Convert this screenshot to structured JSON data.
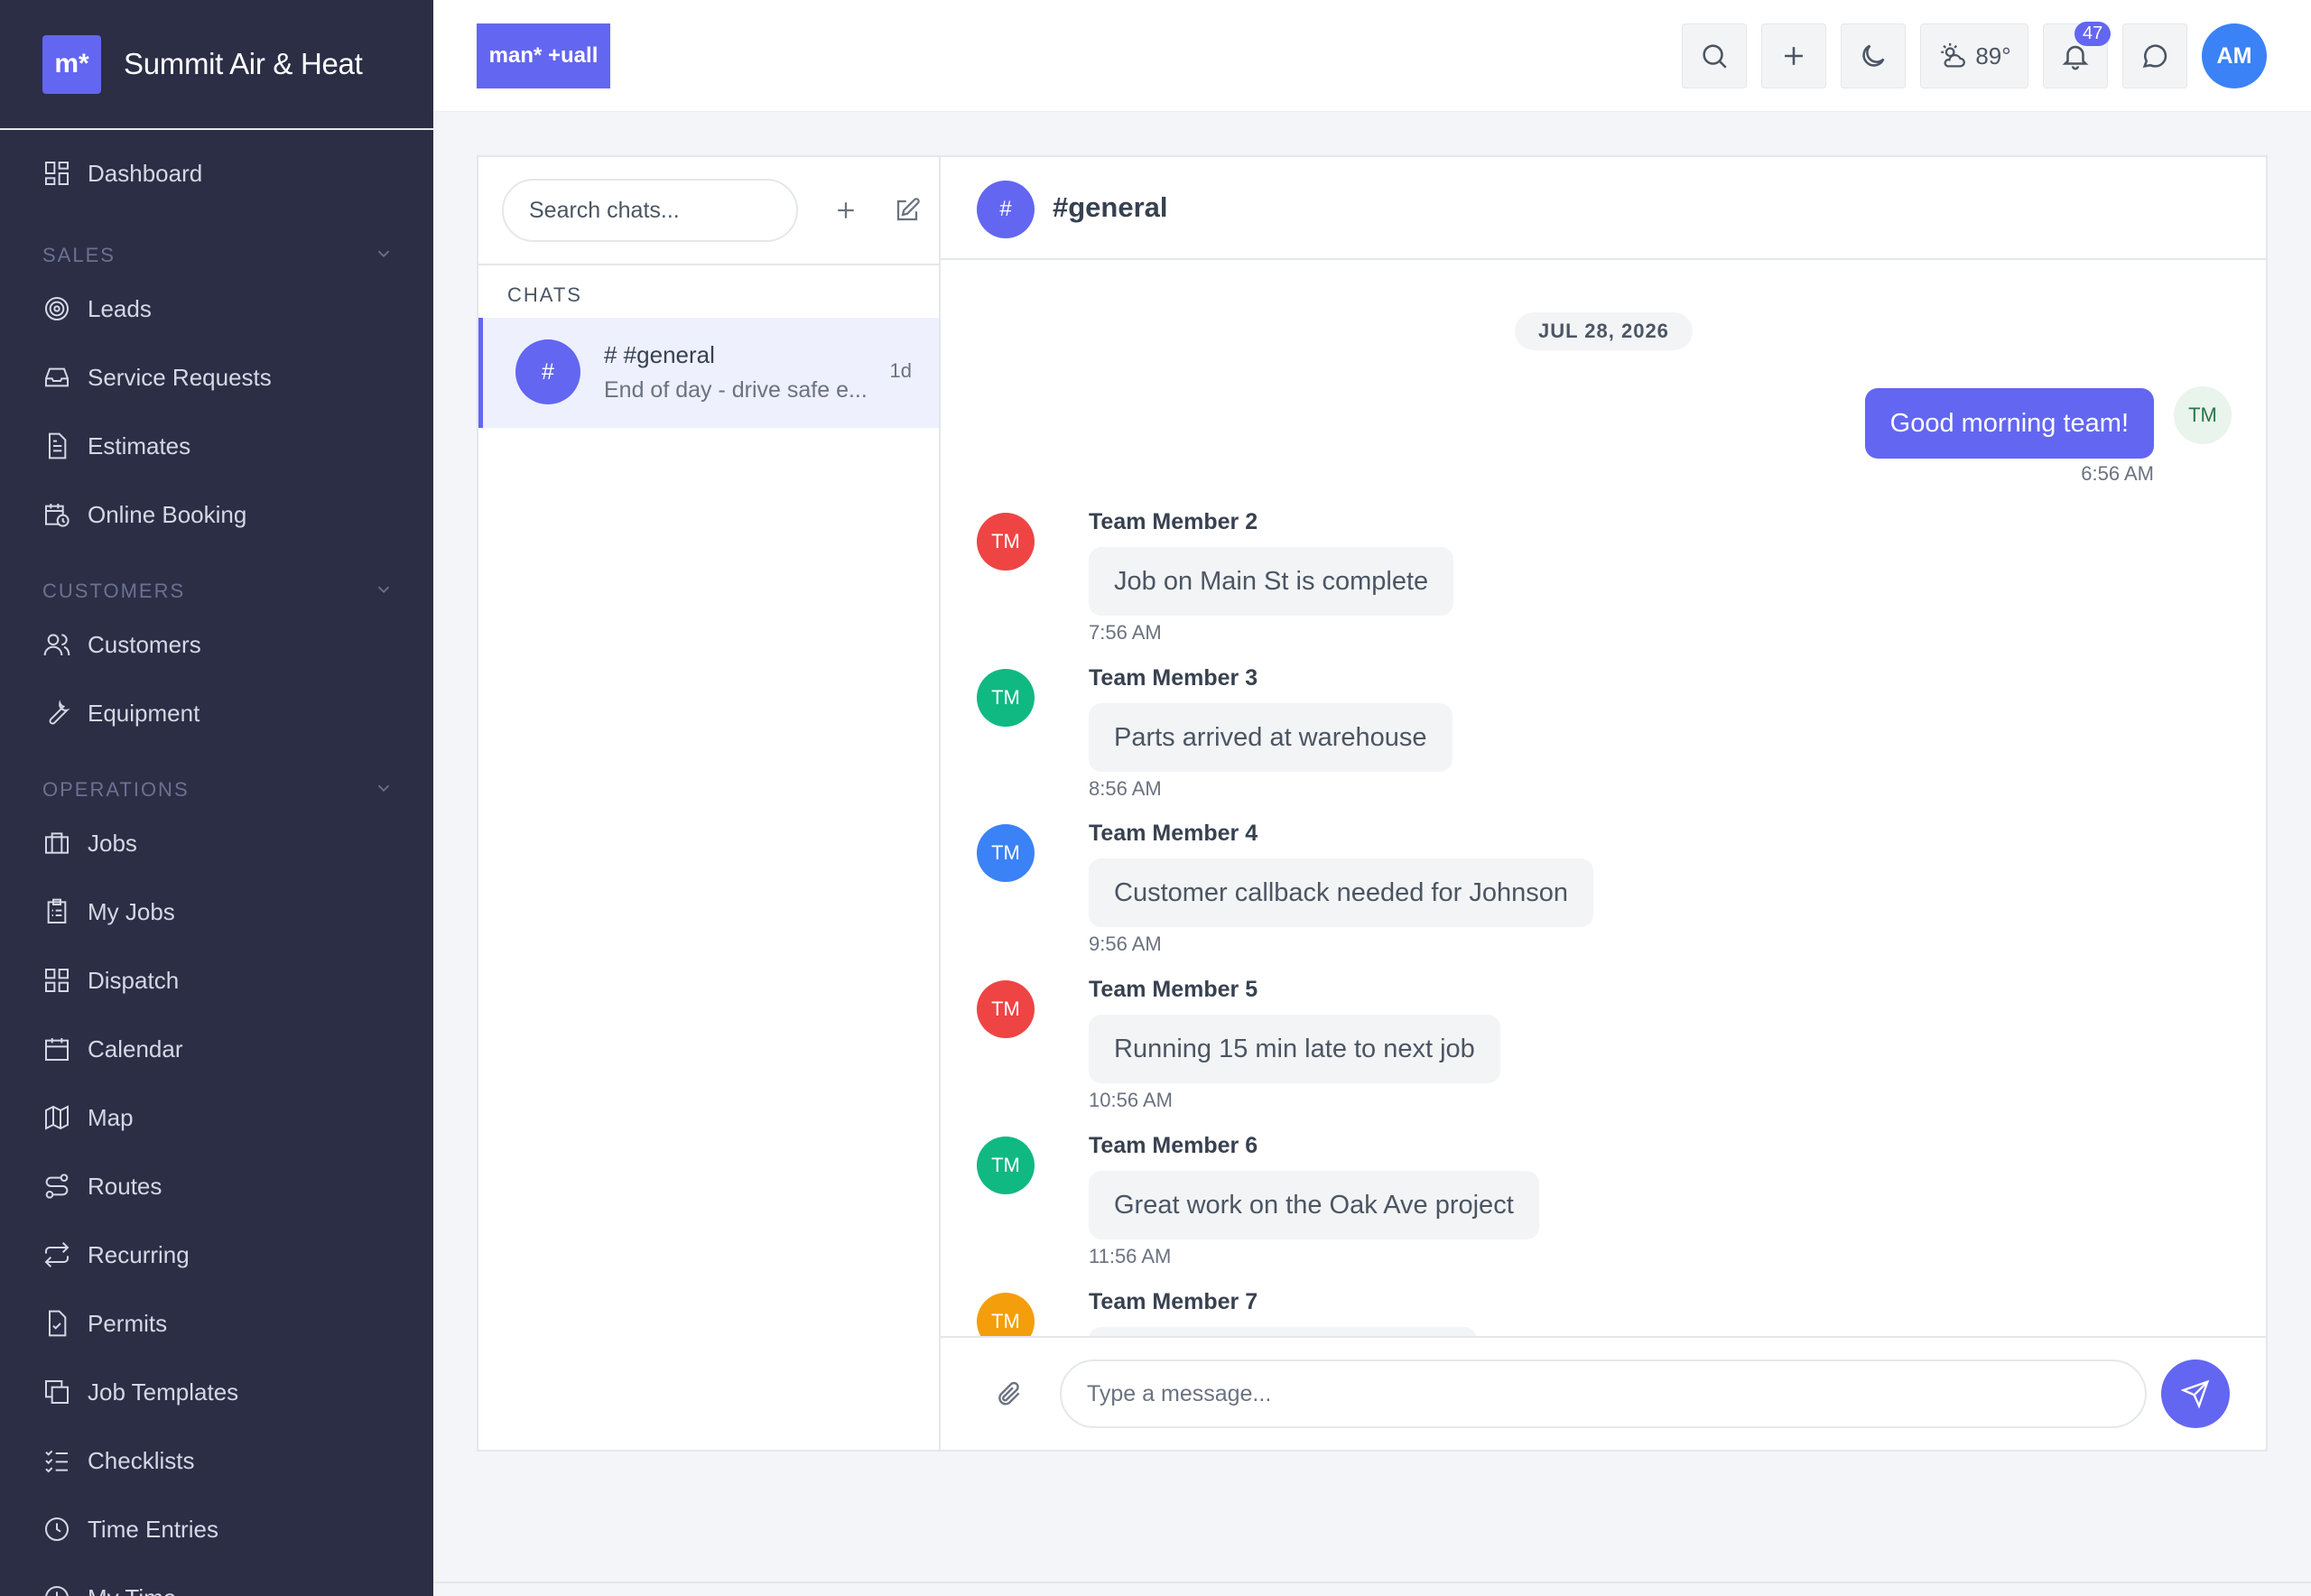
{
  "app": {
    "name": "Summit Air & Heat",
    "logo_glyph": "m*",
    "top_logo_text": "man* +uall"
  },
  "sidebar": {
    "dashboard": "Dashboard",
    "sections": [
      {
        "title": "SALES",
        "items": [
          "Leads",
          "Service Requests",
          "Estimates",
          "Online Booking"
        ]
      },
      {
        "title": "CUSTOMERS",
        "items": [
          "Customers",
          "Equipment"
        ]
      },
      {
        "title": "OPERATIONS",
        "items": [
          "Jobs",
          "My Jobs",
          "Dispatch",
          "Calendar",
          "Map",
          "Routes",
          "Recurring",
          "Permits",
          "Job Templates",
          "Checklists",
          "Time Entries",
          "My Time"
        ]
      }
    ]
  },
  "topbar": {
    "weather": "89°",
    "notifications": "47",
    "user_initials": "AM"
  },
  "chat_list": {
    "search_placeholder": "Search chats...",
    "label": "CHATS",
    "items": [
      {
        "avatar": "#",
        "name": "# #general",
        "preview": "End of day - drive safe e...",
        "time": "1d"
      }
    ]
  },
  "conversation": {
    "avatar": "#",
    "title": "#general",
    "date": "JUL 28, 2026",
    "own_message": {
      "text": "Good morning team!",
      "time": "6:56 AM",
      "avatar": "TM"
    },
    "messages": [
      {
        "author": "Team Member 2",
        "text": "Job on Main St is complete",
        "time": "7:56 AM",
        "avatar": "TM",
        "color": "#ef4444"
      },
      {
        "author": "Team Member 3",
        "text": "Parts arrived at warehouse",
        "time": "8:56 AM",
        "avatar": "TM",
        "color": "#10b981"
      },
      {
        "author": "Team Member 4",
        "text": "Customer callback needed for Johnson",
        "time": "9:56 AM",
        "avatar": "TM",
        "color": "#3b82f6"
      },
      {
        "author": "Team Member 5",
        "text": "Running 15 min late to next job",
        "time": "10:56 AM",
        "avatar": "TM",
        "color": "#ef4444"
      },
      {
        "author": "Team Member 6",
        "text": "Great work on the Oak Ave project",
        "time": "11:56 AM",
        "avatar": "TM",
        "color": "#10b981"
      },
      {
        "author": "Team Member 7",
        "text": "",
        "time": "",
        "avatar": "TM",
        "color": "#f59e0b"
      }
    ],
    "composer_placeholder": "Type a message..."
  },
  "colors": {
    "accent": "#6366f1",
    "sidebar_bg": "#2b2e45"
  }
}
